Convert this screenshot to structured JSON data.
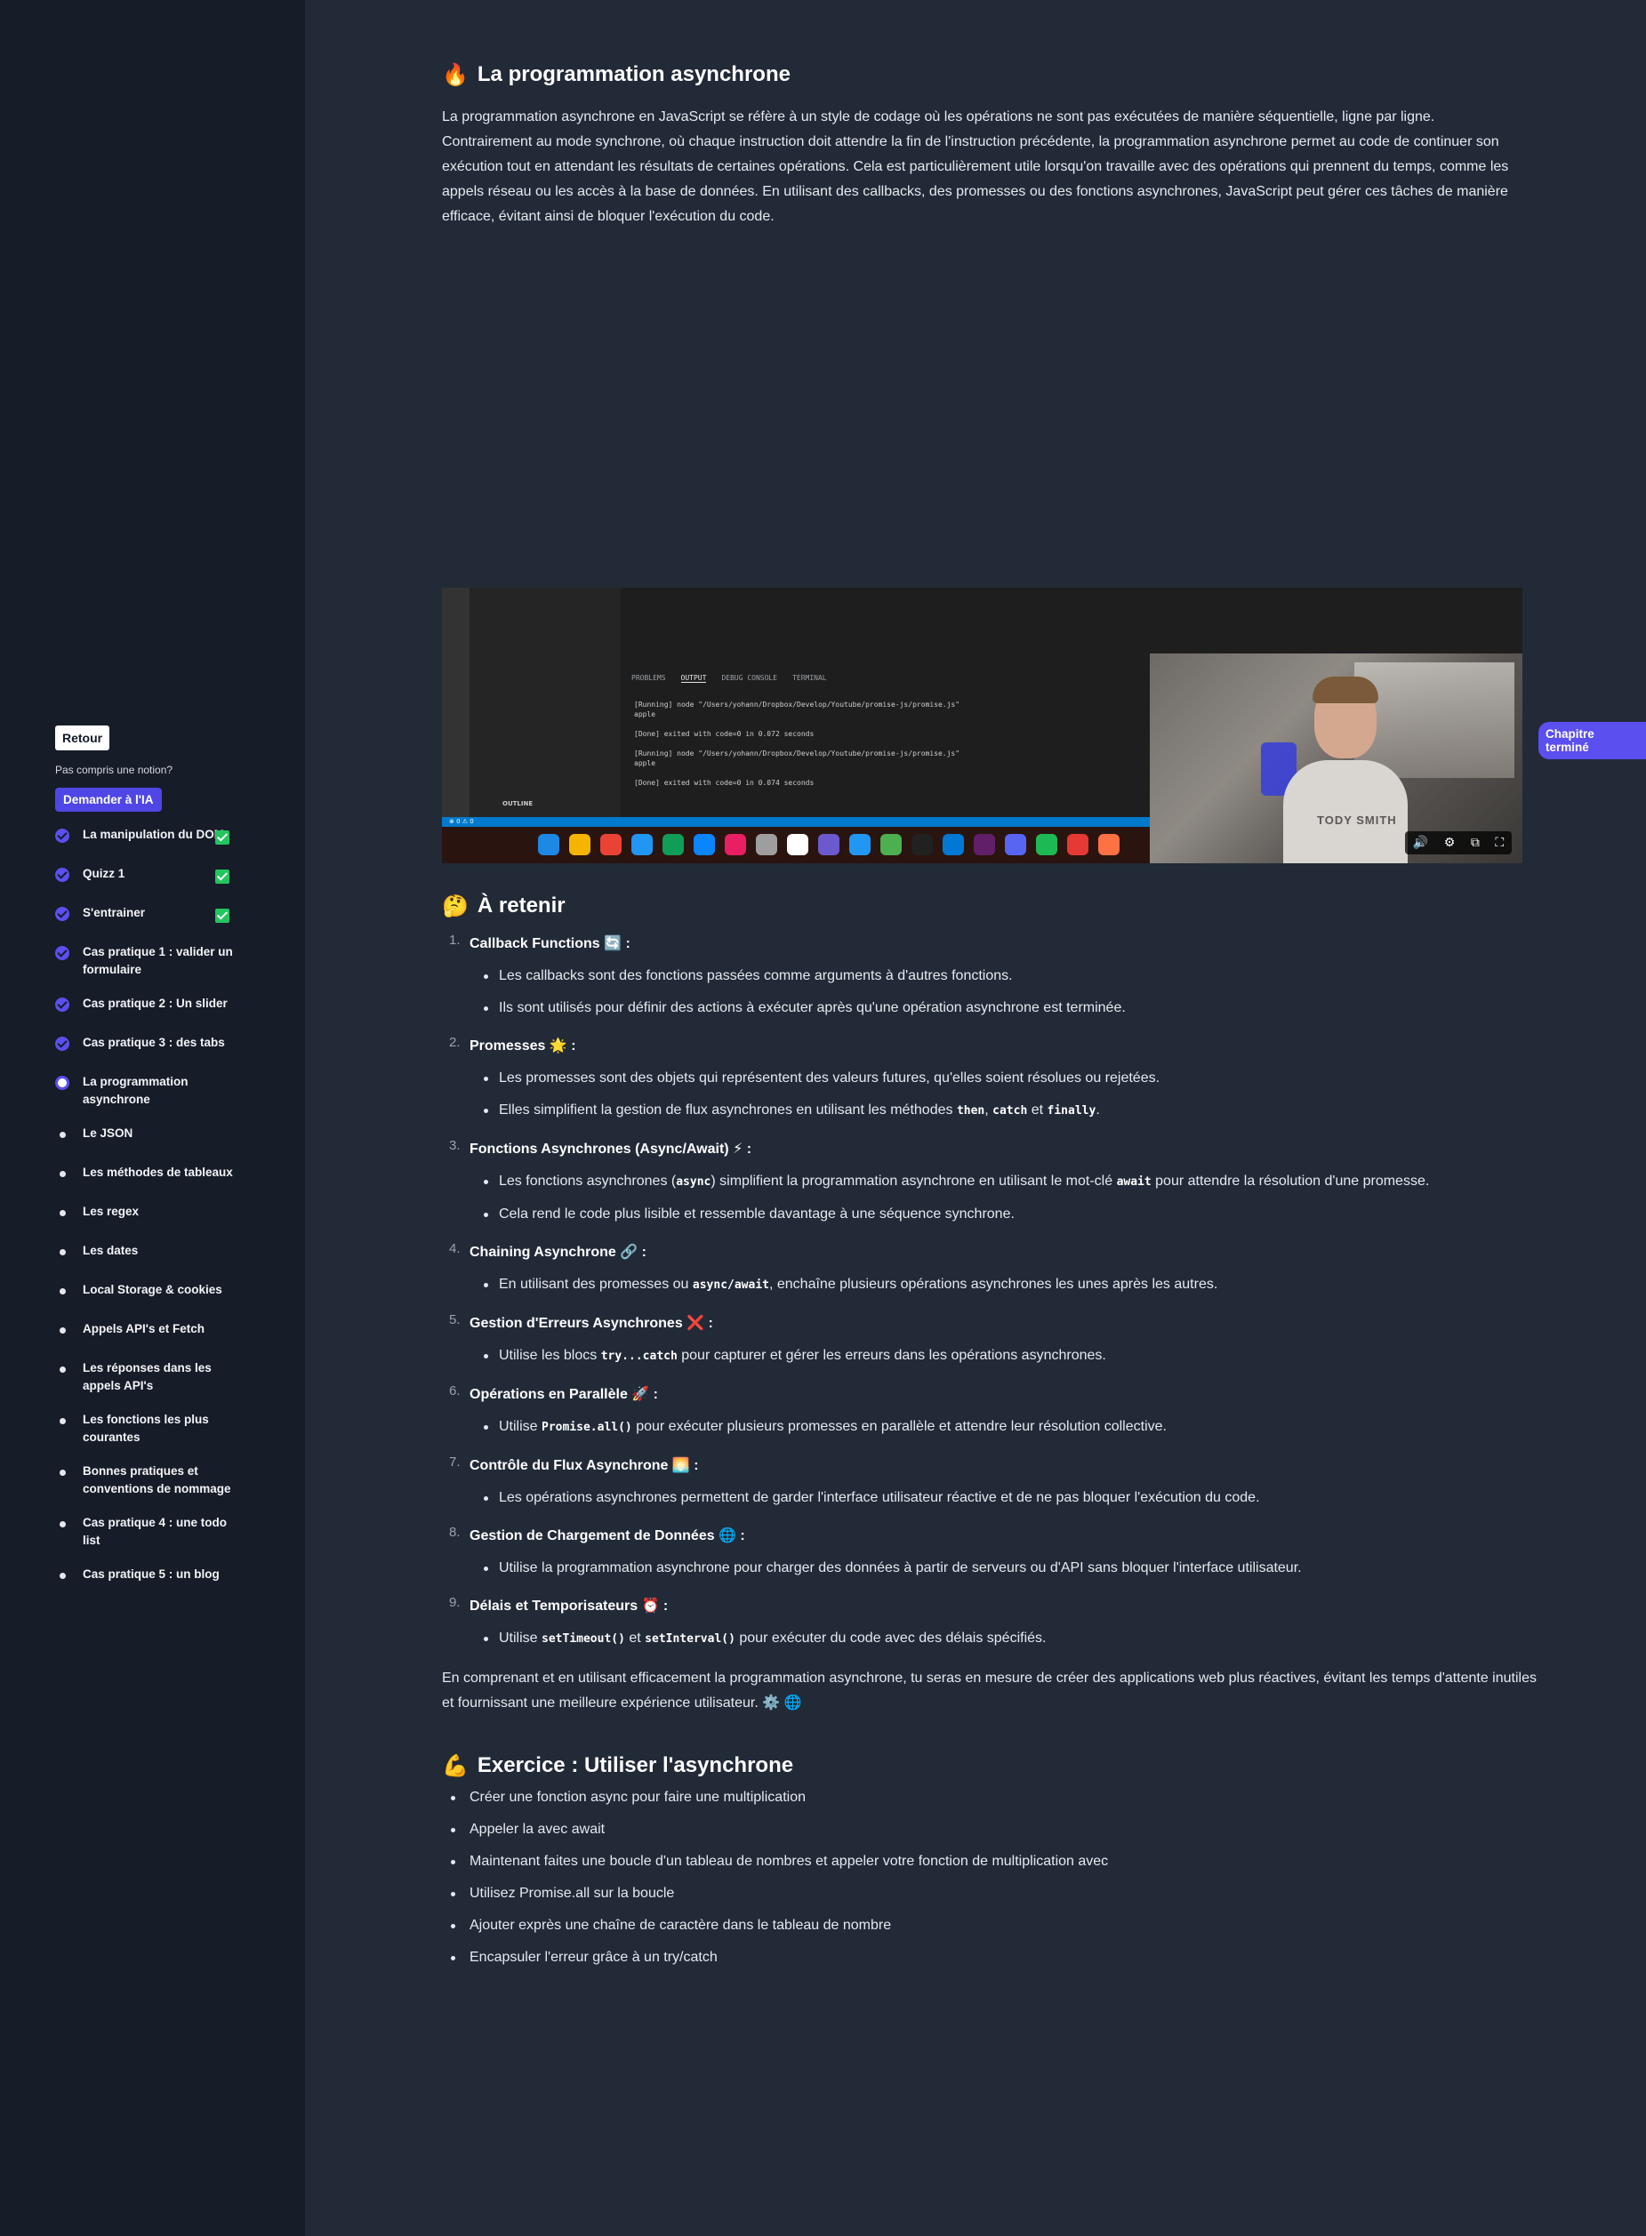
{
  "sidebar": {
    "back_label": "Retour",
    "question": "Pas compris une notion?",
    "ask_ai_label": "Demander à l'IA",
    "items": [
      {
        "label": "La manipulation du DOM",
        "status": "done",
        "checked": true
      },
      {
        "label": "Quizz 1",
        "status": "done",
        "checked": true
      },
      {
        "label": "S'entrainer",
        "status": "done",
        "checked": true
      },
      {
        "label": "Cas pratique 1 : valider un formulaire",
        "status": "done",
        "checked": false
      },
      {
        "label": "Cas pratique 2 : Un slider",
        "status": "done",
        "checked": false
      },
      {
        "label": "Cas pratique 3 : des tabs",
        "status": "done",
        "checked": false
      },
      {
        "label": "La programmation asynchrone",
        "status": "current",
        "checked": false
      },
      {
        "label": "Le JSON",
        "status": "todo",
        "checked": false
      },
      {
        "label": "Les méthodes de tableaux",
        "status": "todo",
        "checked": false
      },
      {
        "label": "Les regex",
        "status": "todo",
        "checked": false
      },
      {
        "label": "Les dates",
        "status": "todo",
        "checked": false
      },
      {
        "label": "Local Storage & cookies",
        "status": "todo",
        "checked": false
      },
      {
        "label": "Appels API's et Fetch",
        "status": "todo",
        "checked": false
      },
      {
        "label": "Les réponses dans les appels API's",
        "status": "todo",
        "checked": false
      },
      {
        "label": "Les fonctions les plus courantes",
        "status": "todo",
        "checked": false
      },
      {
        "label": "Bonnes pratiques et conventions de nommage",
        "status": "todo",
        "checked": false
      },
      {
        "label": "Cas pratique 4 : une todo list",
        "status": "todo",
        "checked": false
      },
      {
        "label": "Cas pratique 5 : un blog",
        "status": "todo",
        "checked": false
      }
    ]
  },
  "header": {
    "icon": "fire-icon",
    "emoji": "🔥",
    "title": "La programmation asynchrone",
    "intro": "La programmation asynchrone en JavaScript se réfère à un style de codage où les opérations ne sont pas exécutées de manière séquentielle, ligne par ligne. Contrairement au mode synchrone, où chaque instruction doit attendre la fin de l'instruction précédente, la programmation asynchrone permet au code de continuer son exécution tout en attendant les résultats de certaines opérations. Cela est particulièrement utile lorsqu'on travaille avec des opérations qui prennent du temps, comme les appels réseau ou les accès à la base de données. En utilisant des callbacks, des promesses ou des fonctions asynchrones, JavaScript peut gérer ces tâches de manière efficace, évitant ainsi de bloquer l'exécution du code."
  },
  "video": {
    "panel_tabs": [
      "PROBLEMS",
      "OUTPUT",
      "DEBUG CONSOLE",
      "TERMINAL"
    ],
    "active_tab": "OUTPUT",
    "output_lines": [
      "[Running] node \"/Users/yohann/Dropbox/Develop/Youtube/promise-js/promise.js\"",
      "apple",
      "",
      "[Done] exited with code=0 in 0.072 seconds",
      "",
      "[Running] node \"/Users/yohann/Dropbox/Develop/Youtube/promise-js/promise.js\"",
      "apple",
      "",
      "[Done] exited with code=0 in 0.074 seconds"
    ],
    "outline_label": "OUTLINE",
    "status_text": "⊗ 0 ⚠ 0",
    "shirt_text": "TODY SMITH",
    "controls": [
      "volume-icon",
      "settings-icon",
      "pip-icon",
      "fullscreen-icon"
    ]
  },
  "chapter_done_label": "Chapitre terminé",
  "retenir": {
    "emoji": "🤔",
    "title": "À retenir",
    "steps": [
      {
        "n": "1.",
        "title": "Callback Functions",
        "emoji": "🔄",
        "bullets": [
          [
            "Les callbacks sont des fonctions passées comme arguments à d'autres fonctions."
          ],
          [
            "Ils sont utilisés pour définir des actions à exécuter après qu'une opération asynchrone est terminée."
          ]
        ]
      },
      {
        "n": "2.",
        "title": "Promesses",
        "emoji": "🌟",
        "bullets": [
          [
            "Les promesses sont des objets qui représentent des valeurs futures, qu'elles soient résolues ou rejetées."
          ],
          [
            "Elles simplifient la gestion de flux asynchrones en utilisant les méthodes ",
            {
              "code": "then"
            },
            ", ",
            {
              "code": "catch"
            },
            " et ",
            {
              "code": "finally"
            },
            "."
          ]
        ]
      },
      {
        "n": "3.",
        "title": "Fonctions Asynchrones (Async/Await)",
        "emoji": "⚡",
        "bullets": [
          [
            "Les fonctions asynchrones (",
            {
              "code": "async"
            },
            ") simplifient la programmation asynchrone en utilisant le mot-clé ",
            {
              "code": "await"
            },
            " pour attendre la résolution d'une promesse."
          ],
          [
            "Cela rend le code plus lisible et ressemble davantage à une séquence synchrone."
          ]
        ]
      },
      {
        "n": "4.",
        "title": "Chaining Asynchrone",
        "emoji": "🔗",
        "bullets": [
          [
            "En utilisant des promesses ou ",
            {
              "code": "async/await"
            },
            ", enchaîne plusieurs opérations asynchrones les unes après les autres."
          ]
        ]
      },
      {
        "n": "5.",
        "title": "Gestion d'Erreurs Asynchrones",
        "emoji": "❌",
        "bullets": [
          [
            "Utilise les blocs ",
            {
              "code": "try...catch"
            },
            " pour capturer et gérer les erreurs dans les opérations asynchrones."
          ]
        ]
      },
      {
        "n": "6.",
        "title": "Opérations en Parallèle",
        "emoji": "🚀",
        "bullets": [
          [
            "Utilise ",
            {
              "code": "Promise.all()"
            },
            " pour exécuter plusieurs promesses en parallèle et attendre leur résolution collective."
          ]
        ]
      },
      {
        "n": "7.",
        "title": "Contrôle du Flux Asynchrone",
        "emoji": "🌅",
        "bullets": [
          [
            "Les opérations asynchrones permettent de garder l'interface utilisateur réactive et de ne pas bloquer l'exécution du code."
          ]
        ]
      },
      {
        "n": "8.",
        "title": "Gestion de Chargement de Données",
        "emoji": "🌐",
        "bullets": [
          [
            "Utilise la programmation asynchrone pour charger des données à partir de serveurs ou d'API sans bloquer l'interface utilisateur."
          ]
        ]
      },
      {
        "n": "9.",
        "title": "Délais et Temporisateurs",
        "emoji": "⏰",
        "bullets": [
          [
            "Utilise ",
            {
              "code": "setTimeout()"
            },
            " et ",
            {
              "code": "setInterval()"
            },
            " pour exécuter du code avec des délais spécifiés."
          ]
        ]
      }
    ],
    "conclusion": "En comprenant et en utilisant efficacement la programmation asynchrone, tu seras en mesure de créer des applications web plus réactives, évitant les temps d'attente inutiles et fournissant une meilleure expérience utilisateur. ⚙️ 🌐"
  },
  "exercise": {
    "emoji": "💪",
    "title": "Exercice : Utiliser l'asynchrone",
    "items": [
      "Créer une fonction async pour faire une multiplication",
      "Appeler la avec await",
      "Maintenant faites une boucle d'un tableau de nombres et appeler votre fonction de multiplication avec",
      "Utilisez Promise.all sur la boucle",
      "Ajouter exprès une chaîne de caractère dans le tableau de nombre",
      "Encapsuler l'erreur grâce à un try/catch"
    ]
  },
  "colors": {
    "accent": "#5b4ff0",
    "check": "#22c55e",
    "bg_main": "#222a38",
    "bg_sidebar": "#161c28"
  }
}
